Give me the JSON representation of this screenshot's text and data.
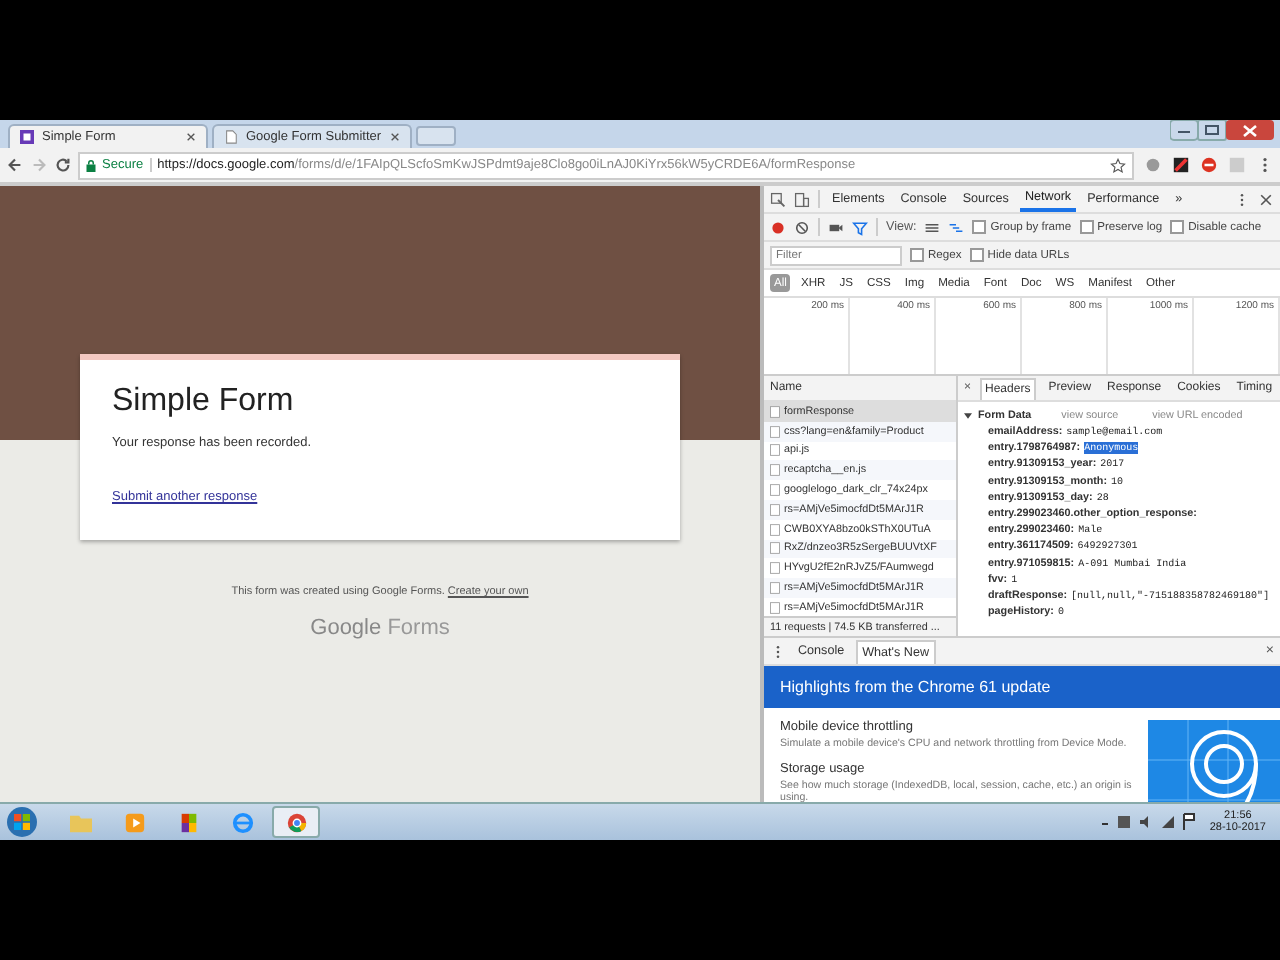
{
  "browser": {
    "tabs": [
      {
        "title": "Simple Form",
        "selected": true
      },
      {
        "title": "Google Form Submitter",
        "selected": false
      }
    ],
    "secure_label": "Secure",
    "url_host": "https://docs.google.com",
    "url_path": "/forms/d/e/1FAIpQLScfoSmKwJSPdmt9aje8Clo8go0iLnAJ0KiYrx56kW5yCRDE6A/formResponse"
  },
  "page": {
    "title": "Simple Form",
    "message": "Your response has been recorded.",
    "link": "Submit another response",
    "footer_text": "This form was created using Google Forms.",
    "footer_link": "Create your own",
    "logo_google": "Google",
    "logo_forms": "Forms"
  },
  "devtools": {
    "panels": [
      {
        "label": "Elements",
        "selected": false
      },
      {
        "label": "Console",
        "selected": false
      },
      {
        "label": "Sources",
        "selected": false
      },
      {
        "label": "Network",
        "selected": true
      },
      {
        "label": "Performance",
        "selected": false
      }
    ],
    "more": "»",
    "view_label": "View:",
    "toolbar_options": [
      {
        "label": "Group by frame",
        "checked": false
      },
      {
        "label": "Preserve log",
        "checked": false
      },
      {
        "label": "Disable cache",
        "checked": false
      }
    ],
    "filter": {
      "placeholder": "Filter"
    },
    "filter_options": [
      {
        "label": "Regex",
        "checked": false
      },
      {
        "label": "Hide data URLs",
        "checked": false
      }
    ],
    "types": [
      {
        "label": "All",
        "selected": true
      },
      {
        "label": "XHR",
        "selected": false
      },
      {
        "label": "JS",
        "selected": false
      },
      {
        "label": "CSS",
        "selected": false
      },
      {
        "label": "Img",
        "selected": false
      },
      {
        "label": "Media",
        "selected": false
      },
      {
        "label": "Font",
        "selected": false
      },
      {
        "label": "Doc",
        "selected": false
      },
      {
        "label": "WS",
        "selected": false
      },
      {
        "label": "Manifest",
        "selected": false
      },
      {
        "label": "Other",
        "selected": false
      }
    ],
    "timeline_ticks": [
      "200 ms",
      "400 ms",
      "600 ms",
      "800 ms",
      "1000 ms",
      "1200 ms"
    ],
    "requests_header": "Name",
    "requests": [
      {
        "name": "formResponse",
        "selected": true
      },
      {
        "name": "css?lang=en&family=Product",
        "selected": false
      },
      {
        "name": "api.js",
        "selected": false
      },
      {
        "name": "recaptcha__en.js",
        "selected": false
      },
      {
        "name": "googlelogo_dark_clr_74x24px",
        "selected": false
      },
      {
        "name": "rs=AMjVe5imocfdDt5MArJ1R",
        "selected": false
      },
      {
        "name": "CWB0XYA8bzo0kSThX0UTuA",
        "selected": false
      },
      {
        "name": "RxZ/dnzeo3R5zSergeBUUVtXF",
        "selected": false
      },
      {
        "name": "HYvgU2fE2nRJvZ5/FAumwegd",
        "selected": false
      },
      {
        "name": "rs=AMjVe5imocfdDt5MArJ1R",
        "selected": false
      },
      {
        "name": "rs=AMjVe5imocfdDt5MArJ1R",
        "selected": false
      }
    ],
    "summary": "11 requests | 74.5 KB transferred ...",
    "detail_close": "×",
    "detail_tabs": [
      {
        "label": "Headers",
        "selected": true
      },
      {
        "label": "Preview",
        "selected": false
      },
      {
        "label": "Response",
        "selected": false
      },
      {
        "label": "Cookies",
        "selected": false
      },
      {
        "label": "Timing",
        "selected": false
      }
    ],
    "form_data_title": "Form Data",
    "form_data_links": [
      "view source",
      "view URL encoded"
    ],
    "form_data": [
      {
        "key": "emailAddress:",
        "value": "sample@email.com",
        "highlighted": false
      },
      {
        "key": "entry.1798764987:",
        "value": "Anonymous",
        "highlighted": true
      },
      {
        "key": "entry.91309153_year:",
        "value": "2017",
        "highlighted": false
      },
      {
        "key": "entry.91309153_month:",
        "value": "10",
        "highlighted": false
      },
      {
        "key": "entry.91309153_day:",
        "value": "28",
        "highlighted": false
      },
      {
        "key": "entry.299023460.other_option_response:",
        "highlighted": false
      },
      {
        "key": "entry.299023460:",
        "value": "Male",
        "highlighted": false
      },
      {
        "key": "entry.361174509:",
        "value": "6492927301",
        "highlighted": false
      },
      {
        "key": "entry.971059815:",
        "value": "A-091 Mumbai India",
        "highlighted": false
      },
      {
        "key": "fvv:",
        "value": "1",
        "highlighted": false
      },
      {
        "key": "draftResponse:",
        "value": "[null,null,\"-715188358782469180\"]",
        "highlighted": false
      },
      {
        "key": "pageHistory:",
        "value": "0",
        "highlighted": false
      }
    ],
    "drawer_tabs": [
      {
        "label": "Console",
        "selected": false
      },
      {
        "label": "What's New",
        "selected": true
      }
    ],
    "drawer_close": "×",
    "banner": "Highlights from the Chrome 61 update",
    "news": [
      {
        "title": "Mobile device throttling",
        "text": "Simulate a mobile device's CPU and network throttling from Device Mode."
      },
      {
        "title": "Storage usage",
        "text": "See how much storage (IndexedDB, local, session, cache, etc.) an origin is using."
      }
    ]
  },
  "taskbar": {
    "apps": [
      {
        "kind": "folder",
        "selected": false
      },
      {
        "kind": "media",
        "selected": false
      },
      {
        "kind": "office",
        "selected": false
      },
      {
        "kind": "ie",
        "selected": false
      },
      {
        "kind": "chrome",
        "selected": true
      }
    ],
    "time": "21:56",
    "date": "28-10-2017"
  }
}
